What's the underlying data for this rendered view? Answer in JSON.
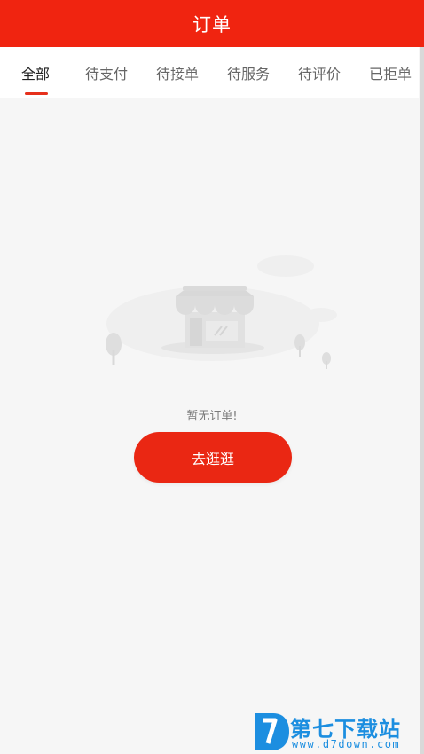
{
  "header": {
    "title": "订单"
  },
  "tabs": [
    {
      "label": "全部",
      "active": true
    },
    {
      "label": "待支付",
      "active": false
    },
    {
      "label": "待接单",
      "active": false
    },
    {
      "label": "待服务",
      "active": false
    },
    {
      "label": "待评价",
      "active": false
    },
    {
      "label": "已拒单",
      "active": false
    }
  ],
  "empty_state": {
    "illustration": "empty-store-icon",
    "message": "暂无订单!",
    "button_label": "去逛逛"
  },
  "watermark": {
    "name": "第七下载站",
    "url": "www.d7down.com"
  },
  "colors": {
    "brand_red": "#f02410",
    "button_red": "#ea2713",
    "watermark_blue": "#1c8ee0"
  }
}
